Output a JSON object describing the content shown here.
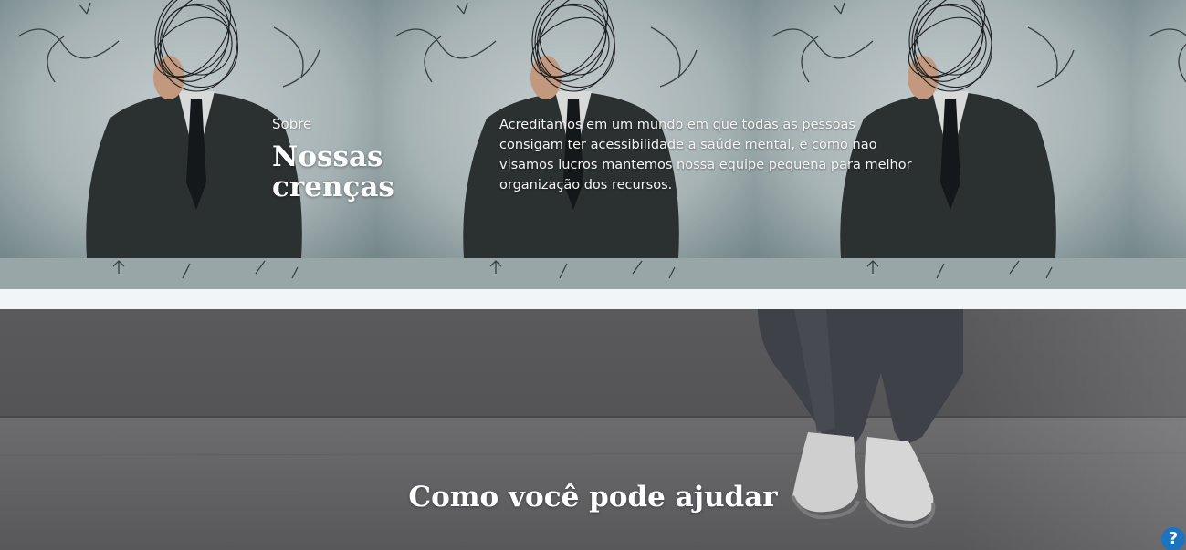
{
  "about": {
    "label": "Sobre",
    "title": "Nossas crenças",
    "text": "Acreditamos em um mundo em que todas as pessoas consigam ter acessibilidade a saúde mental, e como nao visamos lucros mantemos nossa equipe pequena para melhor organização dos recursos."
  },
  "help_section": {
    "title": "Como você pode ajudar"
  },
  "help_widget": {
    "icon": "question-icon",
    "symbol": "?",
    "color": "#1e73be"
  },
  "colors": {
    "page_background": "#f1f5f8",
    "hero_wall": "#c9d3d5",
    "help_background": "#5c5c5f"
  }
}
